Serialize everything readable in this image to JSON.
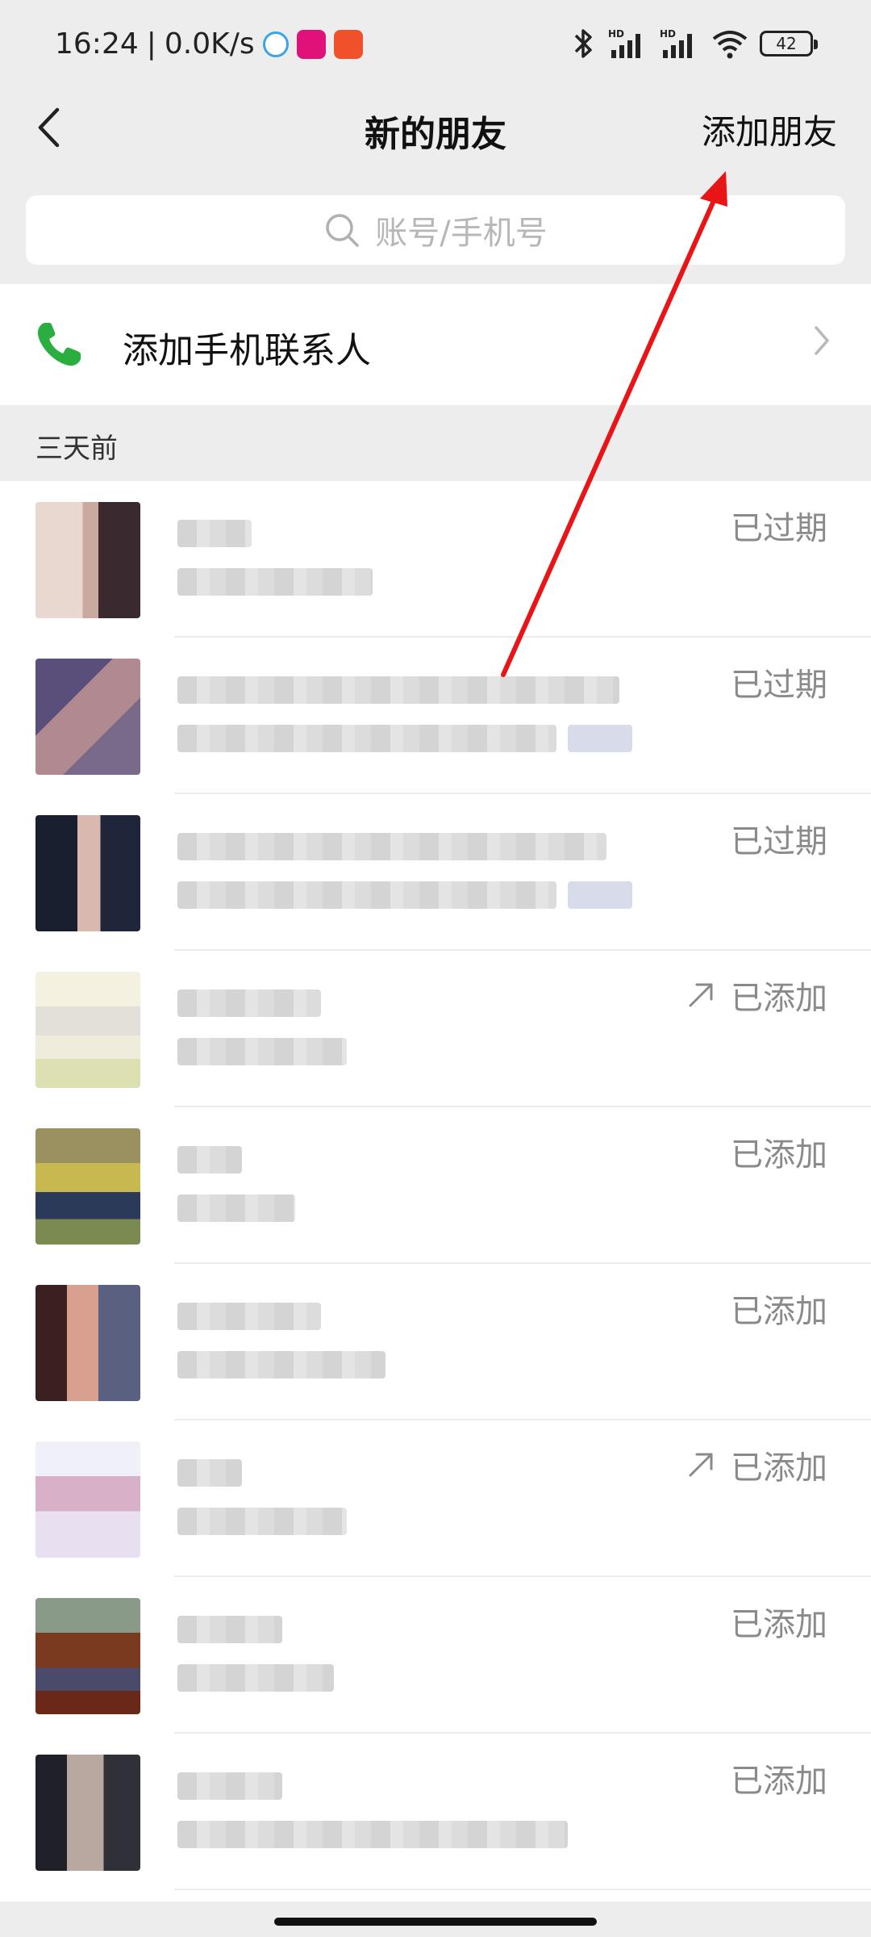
{
  "status_bar": {
    "time": "16:24",
    "speed": "0.0K/s",
    "battery": "42",
    "icons": [
      "bluetooth-icon",
      "signal-hd-icon",
      "signal-hd-icon",
      "wifi-icon"
    ]
  },
  "header": {
    "title": "新的朋友",
    "action": "添加朋友"
  },
  "search": {
    "placeholder": "账号/手机号"
  },
  "phone_contacts": {
    "label": "添加手机联系人"
  },
  "section": {
    "label": "三天前"
  },
  "friend_requests": [
    {
      "status": "已过期",
      "forwarded": false
    },
    {
      "status": "已过期",
      "forwarded": false
    },
    {
      "status": "已过期",
      "forwarded": false
    },
    {
      "status": "已添加",
      "forwarded": true
    },
    {
      "status": "已添加",
      "forwarded": false
    },
    {
      "status": "已添加",
      "forwarded": false
    },
    {
      "status": "已添加",
      "forwarded": true
    },
    {
      "status": "已添加",
      "forwarded": false
    },
    {
      "status": "已添加",
      "forwarded": false
    }
  ],
  "colors": {
    "background": "#ededed",
    "phone_green": "#2aae3f",
    "status_gray": "#8a8a8a",
    "annotation_red": "#e81416"
  }
}
